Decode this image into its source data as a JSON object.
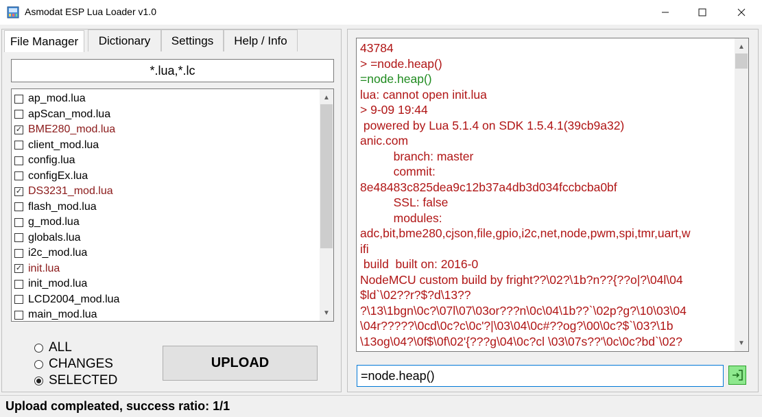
{
  "window": {
    "title": "Asmodat ESP Lua Loader v1.0",
    "minimize_icon": "minimize-icon",
    "maximize_icon": "maximize-icon",
    "close_icon": "close-icon"
  },
  "tabs": [
    {
      "label": "File Manager",
      "active": true
    },
    {
      "label": "Dictionary",
      "active": false
    },
    {
      "label": "Settings",
      "active": false
    },
    {
      "label": "Help / Info",
      "active": false
    }
  ],
  "file_manager": {
    "filter": "*.lua,*.lc",
    "files": [
      {
        "name": "ap_mod.lua",
        "checked": false
      },
      {
        "name": "apScan_mod.lua",
        "checked": false
      },
      {
        "name": "BME280_mod.lua",
        "checked": true
      },
      {
        "name": "client_mod.lua",
        "checked": false
      },
      {
        "name": "config.lua",
        "checked": false
      },
      {
        "name": "configEx.lua",
        "checked": false
      },
      {
        "name": "DS3231_mod.lua",
        "checked": true
      },
      {
        "name": "flash_mod.lua",
        "checked": false
      },
      {
        "name": "g_mod.lua",
        "checked": false
      },
      {
        "name": "globals.lua",
        "checked": false
      },
      {
        "name": "i2c_mod.lua",
        "checked": false
      },
      {
        "name": "init.lua",
        "checked": true
      },
      {
        "name": "init_mod.lua",
        "checked": false
      },
      {
        "name": "LCD2004_mod.lua",
        "checked": false
      },
      {
        "name": "main_mod.lua",
        "checked": false
      }
    ],
    "upload_mode": {
      "options": [
        "ALL",
        "CHANGES",
        "SELECTED"
      ],
      "selected": "SELECTED"
    },
    "upload_label": "UPLOAD"
  },
  "console": {
    "lines": [
      {
        "text": "43784",
        "color": "#b01515"
      },
      {
        "text": "> =node.heap()",
        "color": "#b01515"
      },
      {
        "text": "=node.heap()",
        "color": "#1f8b1f"
      },
      {
        "text": "lua: cannot open init.lua",
        "color": "#b01515"
      },
      {
        "text": "> 9-09 19:44",
        "color": "#b01515"
      },
      {
        "text": " powered by Lua 5.1.4 on SDK 1.5.4.1(39cb9a32)",
        "color": "#b01515"
      },
      {
        "text": "anic.com",
        "color": "#b01515"
      },
      {
        "text": "          branch: master",
        "color": "#b01515"
      },
      {
        "text": "          commit:",
        "color": "#b01515"
      },
      {
        "text": "8e48483c825dea9c12b37a4db3d034fccbcba0bf",
        "color": "#b01515"
      },
      {
        "text": "          SSL: false",
        "color": "#b01515"
      },
      {
        "text": "          modules:",
        "color": "#b01515"
      },
      {
        "text": "adc,bit,bme280,cjson,file,gpio,i2c,net,node,pwm,spi,tmr,uart,w",
        "color": "#b01515"
      },
      {
        "text": "ifi",
        "color": "#b01515"
      },
      {
        "text": " build  built on: 2016-0",
        "color": "#b01515"
      },
      {
        "text": "NodeMCU custom build by fright??\\02?\\1b?n??{??o|?\\04l\\04",
        "color": "#b01515"
      },
      {
        "text": "$ld`\\02??r?$?d\\13??",
        "color": "#b01515"
      },
      {
        "text": "?\\13\\1bgn\\0c?\\07l\\07\\03or???n\\0c\\04\\1b??`\\02p?g?\\10\\03\\04",
        "color": "#b01515"
      },
      {
        "text": "\\04r?????\\0cd\\0c?c\\0c'?|\\03\\04\\0c#??og?\\00\\0c?$`\\03?\\1b",
        "color": "#b01515"
      },
      {
        "text": "\\13og\\04?\\0f$\\0f\\02'{???g\\04\\0c?cl \\03\\07s??'\\0c\\0c?bd`\\02?",
        "color": "#b01515"
      }
    ],
    "command_input": "=node.heap()",
    "send_icon": "send-arrow-icon"
  },
  "status": {
    "text": "Upload compleated, success ratio: 1/1"
  }
}
